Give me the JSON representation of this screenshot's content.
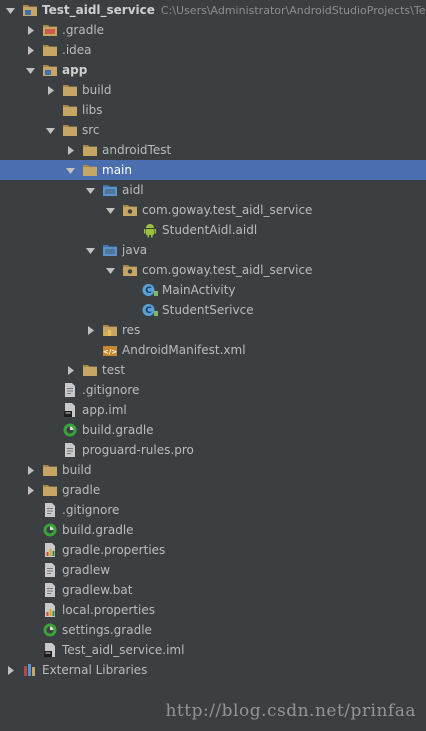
{
  "project": {
    "name": "Test_aidl_service",
    "path": "C:\\Users\\Administrator\\AndroidStudioProjects\\Test_a"
  },
  "tree": [
    {
      "label": "Test_aidl_service",
      "depth": 0,
      "arrow": "down",
      "icon": "project-module-icon",
      "bold": true
    },
    {
      "label": ".gradle",
      "depth": 1,
      "arrow": "right",
      "icon": "folder-excluded-icon"
    },
    {
      "label": ".idea",
      "depth": 1,
      "arrow": "right",
      "icon": "folder-icon"
    },
    {
      "label": "app",
      "depth": 1,
      "arrow": "down",
      "icon": "module-icon",
      "bold": true
    },
    {
      "label": "build",
      "depth": 2,
      "arrow": "right",
      "icon": "folder-icon"
    },
    {
      "label": "libs",
      "depth": 2,
      "arrow": "none",
      "icon": "folder-icon"
    },
    {
      "label": "src",
      "depth": 2,
      "arrow": "down",
      "icon": "folder-icon"
    },
    {
      "label": "androidTest",
      "depth": 3,
      "arrow": "right",
      "icon": "folder-icon"
    },
    {
      "label": "main",
      "depth": 3,
      "arrow": "down",
      "icon": "folder-icon",
      "selected": true
    },
    {
      "label": "aidl",
      "depth": 4,
      "arrow": "down",
      "icon": "source-folder-icon"
    },
    {
      "label": "com.goway.test_aidl_service",
      "depth": 5,
      "arrow": "down",
      "icon": "package-icon"
    },
    {
      "label": "StudentAidl.aidl",
      "depth": 6,
      "arrow": "none",
      "icon": "android-file-icon"
    },
    {
      "label": "java",
      "depth": 4,
      "arrow": "down",
      "icon": "source-folder-icon"
    },
    {
      "label": "com.goway.test_aidl_service",
      "depth": 5,
      "arrow": "down",
      "icon": "package-icon"
    },
    {
      "label": "MainActivity",
      "depth": 6,
      "arrow": "none",
      "icon": "java-class-icon"
    },
    {
      "label": "StudentSerivce",
      "depth": 6,
      "arrow": "none",
      "icon": "java-class-icon"
    },
    {
      "label": "res",
      "depth": 4,
      "arrow": "right",
      "icon": "resource-folder-icon"
    },
    {
      "label": "AndroidManifest.xml",
      "depth": 4,
      "arrow": "none",
      "icon": "xml-manifest-icon"
    },
    {
      "label": "test",
      "depth": 3,
      "arrow": "right",
      "icon": "folder-icon"
    },
    {
      "label": ".gitignore",
      "depth": 2,
      "arrow": "none",
      "icon": "text-file-icon"
    },
    {
      "label": "app.iml",
      "depth": 2,
      "arrow": "none",
      "icon": "iml-file-icon"
    },
    {
      "label": "build.gradle",
      "depth": 2,
      "arrow": "none",
      "icon": "gradle-file-icon"
    },
    {
      "label": "proguard-rules.pro",
      "depth": 2,
      "arrow": "none",
      "icon": "text-file-icon"
    },
    {
      "label": "build",
      "depth": 1,
      "arrow": "right",
      "icon": "folder-icon"
    },
    {
      "label": "gradle",
      "depth": 1,
      "arrow": "right",
      "icon": "folder-icon"
    },
    {
      "label": ".gitignore",
      "depth": 1,
      "arrow": "none",
      "icon": "text-file-icon"
    },
    {
      "label": "build.gradle",
      "depth": 1,
      "arrow": "none",
      "icon": "gradle-file-icon"
    },
    {
      "label": "gradle.properties",
      "depth": 1,
      "arrow": "none",
      "icon": "properties-file-icon"
    },
    {
      "label": "gradlew",
      "depth": 1,
      "arrow": "none",
      "icon": "text-file-icon"
    },
    {
      "label": "gradlew.bat",
      "depth": 1,
      "arrow": "none",
      "icon": "text-file-icon"
    },
    {
      "label": "local.properties",
      "depth": 1,
      "arrow": "none",
      "icon": "properties-file-icon"
    },
    {
      "label": "settings.gradle",
      "depth": 1,
      "arrow": "none",
      "icon": "gradle-file-icon"
    },
    {
      "label": "Test_aidl_service.iml",
      "depth": 1,
      "arrow": "none",
      "icon": "iml-file-icon"
    },
    {
      "label": "External Libraries",
      "depth": 0,
      "arrow": "right",
      "icon": "library-icon"
    }
  ],
  "watermark": "http://blog.csdn.net/prinfaa",
  "colors": {
    "background": "#3c3f41",
    "selection": "#4b6eaf",
    "folder": "#c6a664",
    "source_folder": "#5a93cb",
    "text": "#bbbbbb"
  }
}
